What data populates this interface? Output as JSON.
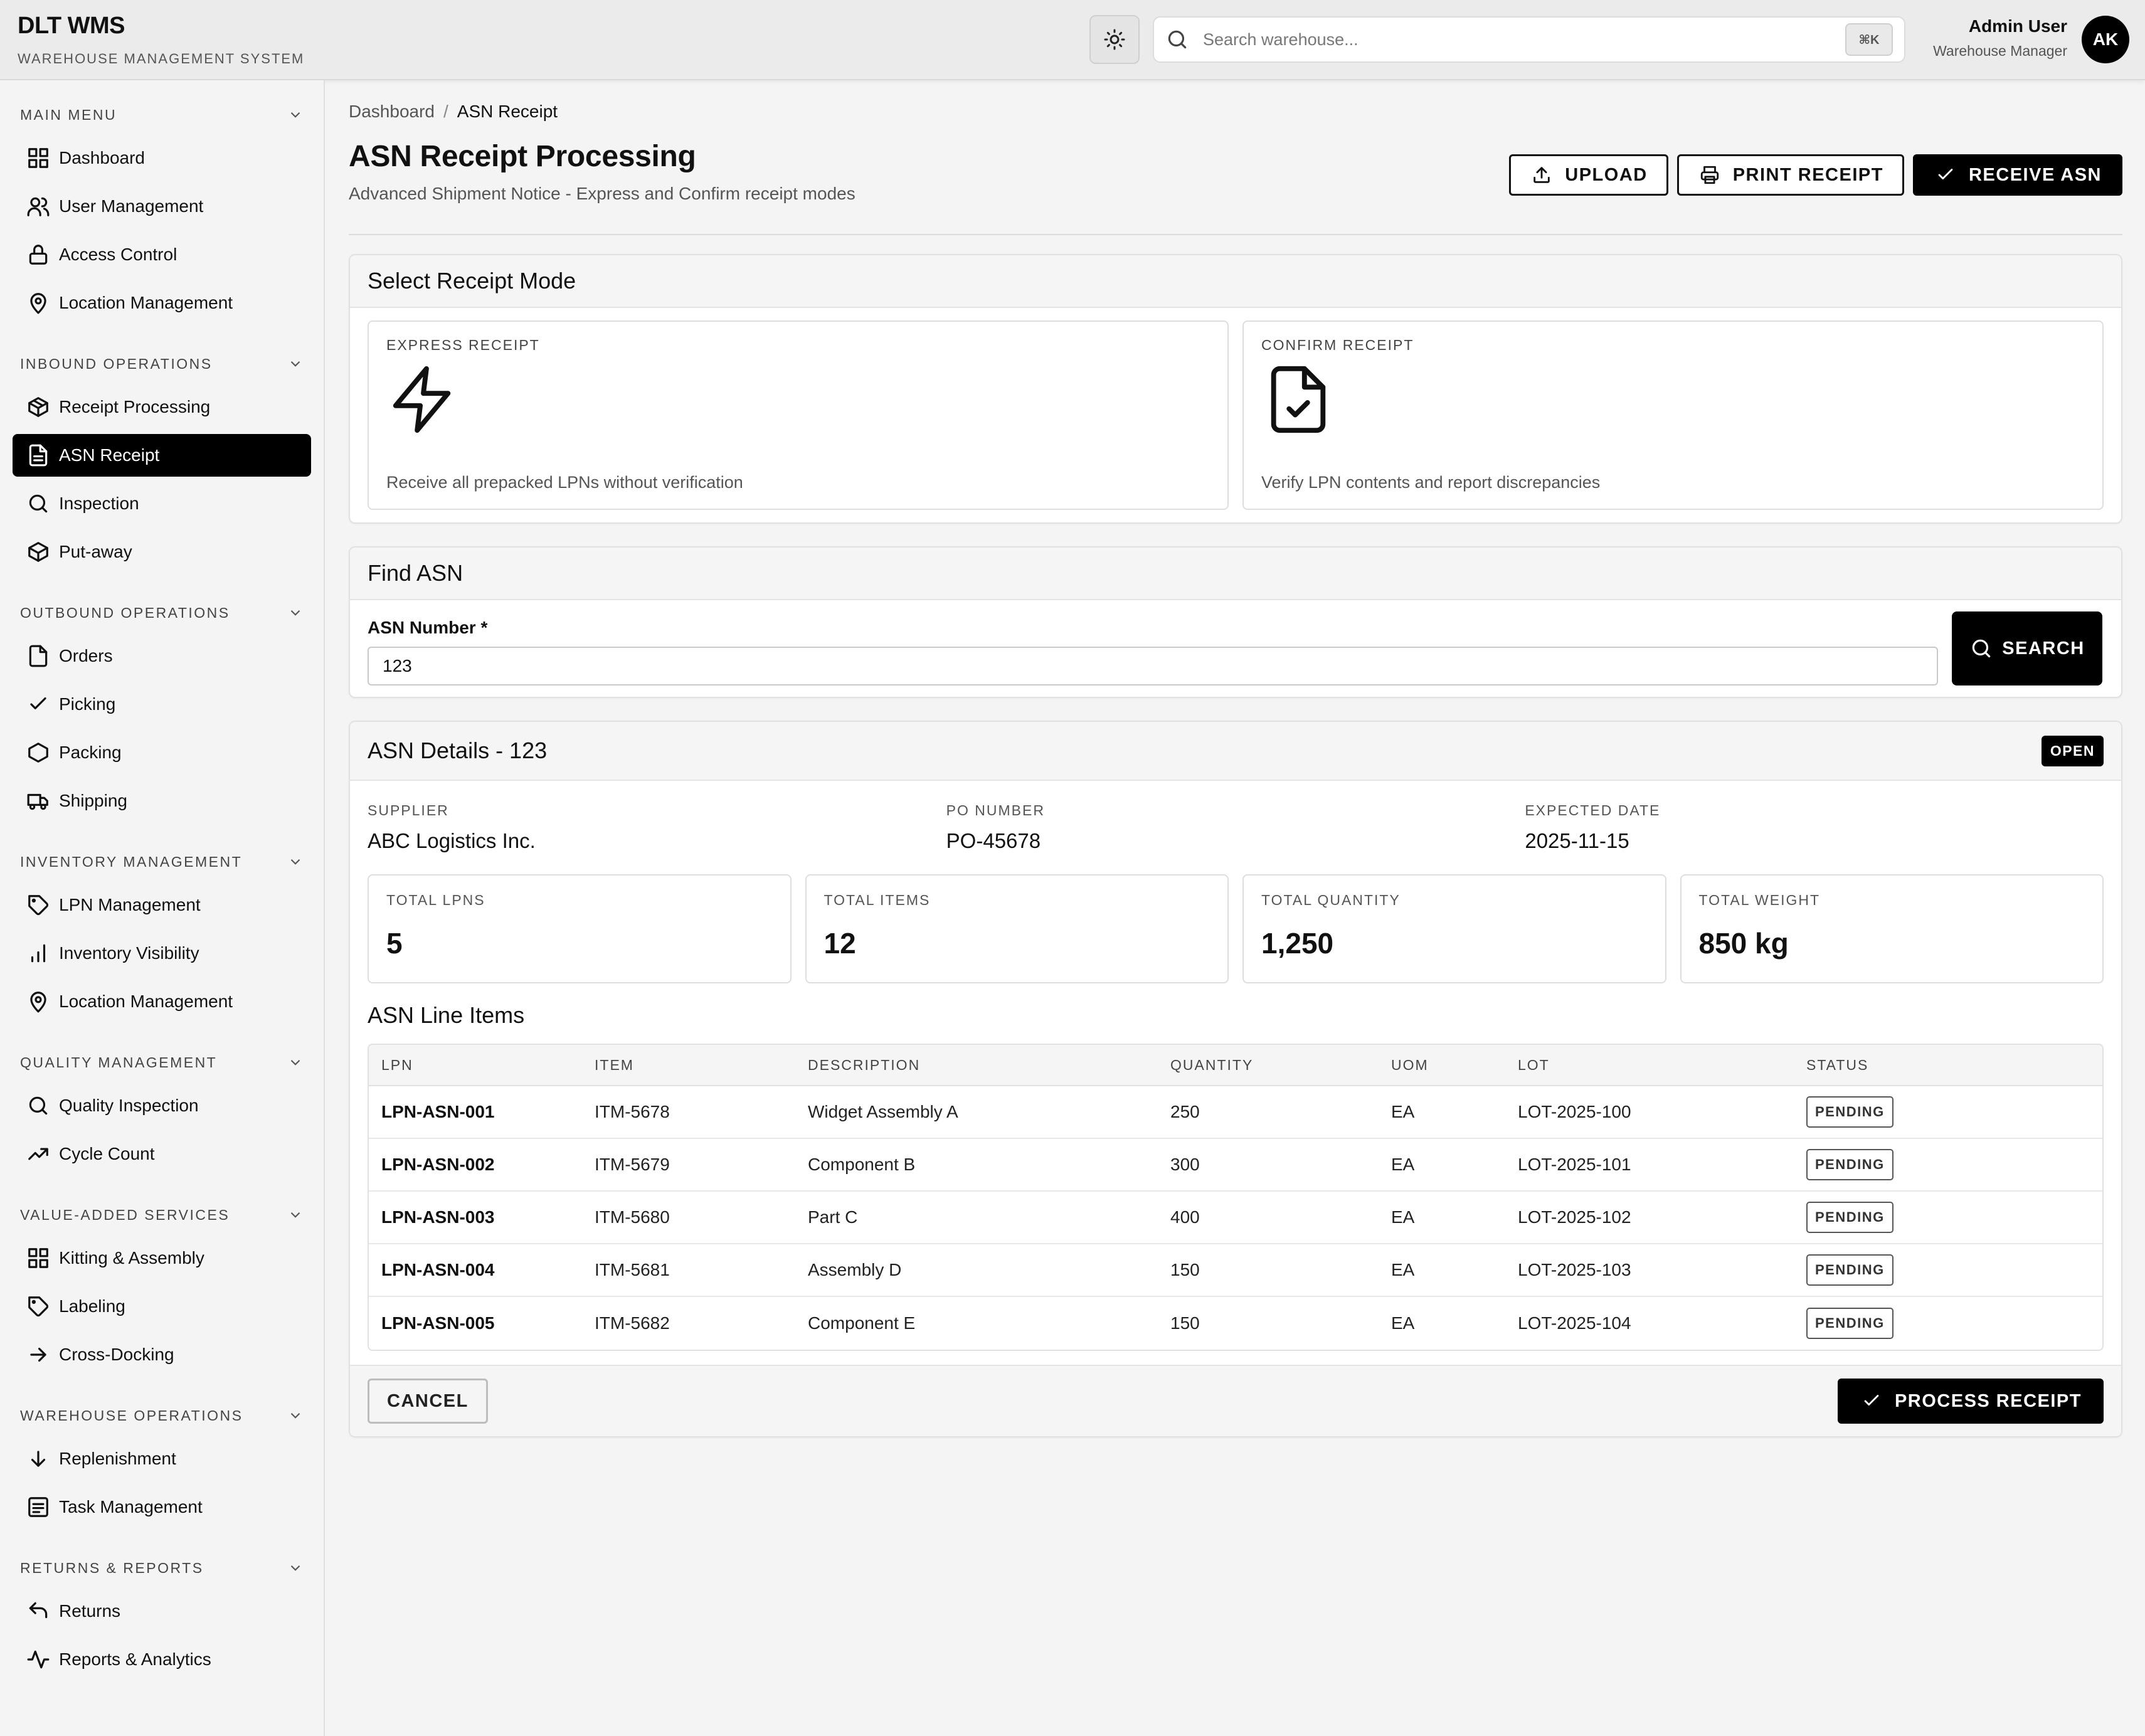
{
  "app": {
    "name": "DLT WMS",
    "tagline": "WAREHOUSE MANAGEMENT SYSTEM"
  },
  "header": {
    "search_placeholder": "Search warehouse...",
    "shortcut": "⌘K",
    "user_name": "Admin User",
    "user_role": "Warehouse Manager",
    "avatar_initials": "AK"
  },
  "sidebar": {
    "sections": [
      {
        "title": "MAIN MENU",
        "items": [
          {
            "label": "Dashboard",
            "icon": "grid-icon"
          },
          {
            "label": "User Management",
            "icon": "users-icon"
          },
          {
            "label": "Access Control",
            "icon": "lock-icon"
          },
          {
            "label": "Location Management",
            "icon": "map-pin-icon"
          }
        ]
      },
      {
        "title": "INBOUND OPERATIONS",
        "items": [
          {
            "label": "Receipt Processing",
            "icon": "package-icon"
          },
          {
            "label": "ASN Receipt",
            "icon": "file-text-icon",
            "active": true
          },
          {
            "label": "Inspection",
            "icon": "search-icon"
          },
          {
            "label": "Put-away",
            "icon": "box-icon"
          }
        ]
      },
      {
        "title": "OUTBOUND OPERATIONS",
        "items": [
          {
            "label": "Orders",
            "icon": "file-icon"
          },
          {
            "label": "Picking",
            "icon": "check-icon"
          },
          {
            "label": "Packing",
            "icon": "hexagon-icon"
          },
          {
            "label": "Shipping",
            "icon": "truck-icon"
          }
        ]
      },
      {
        "title": "INVENTORY MANAGEMENT",
        "items": [
          {
            "label": "LPN Management",
            "icon": "tag-icon"
          },
          {
            "label": "Inventory Visibility",
            "icon": "bar-chart-icon"
          },
          {
            "label": "Location Management",
            "icon": "map-pin-icon"
          }
        ]
      },
      {
        "title": "QUALITY MANAGEMENT",
        "items": [
          {
            "label": "Quality Inspection",
            "icon": "search-icon"
          },
          {
            "label": "Cycle Count",
            "icon": "trending-up-icon"
          }
        ]
      },
      {
        "title": "VALUE-ADDED SERVICES",
        "items": [
          {
            "label": "Kitting & Assembly",
            "icon": "grid-icon"
          },
          {
            "label": "Labeling",
            "icon": "tag-icon"
          },
          {
            "label": "Cross-Docking",
            "icon": "arrow-right-icon"
          }
        ]
      },
      {
        "title": "WAREHOUSE OPERATIONS",
        "items": [
          {
            "label": "Replenishment",
            "icon": "arrow-down-icon"
          },
          {
            "label": "Task Management",
            "icon": "list-icon"
          }
        ]
      },
      {
        "title": "RETURNS & REPORTS",
        "items": [
          {
            "label": "Returns",
            "icon": "return-icon"
          },
          {
            "label": "Reports & Analytics",
            "icon": "activity-icon"
          }
        ]
      }
    ]
  },
  "page": {
    "breadcrumb": [
      "Dashboard",
      "ASN Receipt"
    ],
    "title": "ASN Receipt Processing",
    "subtitle": "Advanced Shipment Notice - Express and Confirm receipt modes",
    "actions": {
      "upload": "UPLOAD",
      "print": "PRINT RECEIPT",
      "receive": "RECEIVE ASN"
    }
  },
  "receipt_mode": {
    "title": "Select Receipt Mode",
    "express": {
      "label": "EXPRESS RECEIPT",
      "icon": "lightning-icon",
      "description": "Receive all prepacked LPNs without verification"
    },
    "confirm": {
      "label": "CONFIRM RECEIPT",
      "icon": "file-check-icon",
      "description": "Verify LPN contents and report discrepancies"
    }
  },
  "find_asn": {
    "title": "Find ASN",
    "field_label": "ASN Number *",
    "value": "123",
    "search_label": "SEARCH"
  },
  "asn_details": {
    "title": "ASN Details - 123",
    "status": "OPEN",
    "meta": [
      {
        "label": "SUPPLIER",
        "value": "ABC Logistics Inc."
      },
      {
        "label": "PO NUMBER",
        "value": "PO-45678"
      },
      {
        "label": "EXPECTED DATE",
        "value": "2025-11-15"
      }
    ],
    "stats": [
      {
        "label": "TOTAL LPNS",
        "value": "5"
      },
      {
        "label": "TOTAL ITEMS",
        "value": "12"
      },
      {
        "label": "TOTAL QUANTITY",
        "value": "1,250"
      },
      {
        "label": "TOTAL WEIGHT",
        "value": "850 kg"
      }
    ],
    "line_items_title": "ASN Line Items",
    "columns": [
      "LPN",
      "ITEM",
      "DESCRIPTION",
      "QUANTITY",
      "UOM",
      "LOT",
      "STATUS"
    ],
    "rows": [
      [
        "LPN-ASN-001",
        "ITM-5678",
        "Widget Assembly A",
        "250",
        "EA",
        "LOT-2025-100",
        "PENDING"
      ],
      [
        "LPN-ASN-002",
        "ITM-5679",
        "Component B",
        "300",
        "EA",
        "LOT-2025-101",
        "PENDING"
      ],
      [
        "LPN-ASN-003",
        "ITM-5680",
        "Part C",
        "400",
        "EA",
        "LOT-2025-102",
        "PENDING"
      ],
      [
        "LPN-ASN-004",
        "ITM-5681",
        "Assembly D",
        "150",
        "EA",
        "LOT-2025-103",
        "PENDING"
      ],
      [
        "LPN-ASN-005",
        "ITM-5682",
        "Component E",
        "150",
        "EA",
        "LOT-2025-104",
        "PENDING"
      ]
    ],
    "cancel_label": "CANCEL",
    "process_label": "PROCESS RECEIPT"
  }
}
